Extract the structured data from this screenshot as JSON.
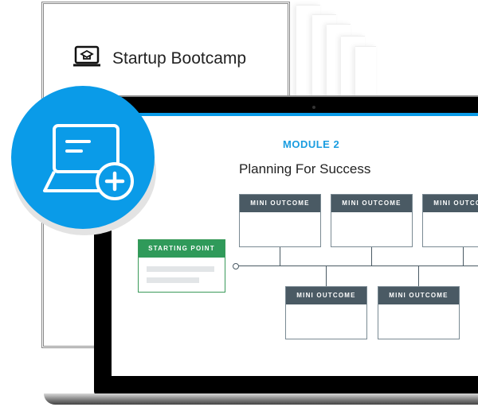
{
  "document": {
    "title": "Startup Bootcamp",
    "icon": "graduation-laptop-icon"
  },
  "badge": {
    "icon": "laptop-add-icon",
    "color": "#0a9be8"
  },
  "screen": {
    "accent": "#0a9be8",
    "module_label": "MODULE 2",
    "title": "Planning For Success",
    "starting_point": {
      "label": "STARTING POINT",
      "color": "#2f9a5a"
    },
    "outcomes_top": [
      {
        "label": "MINI OUTCOME"
      },
      {
        "label": "MINI OUTCOME"
      },
      {
        "label": "MINI OUTCOME"
      }
    ],
    "outcomes_bottom": [
      {
        "label": "MINI OUTCOME"
      },
      {
        "label": "MINI OUTCOME"
      }
    ],
    "outcome_header_color": "#4a5a64"
  }
}
